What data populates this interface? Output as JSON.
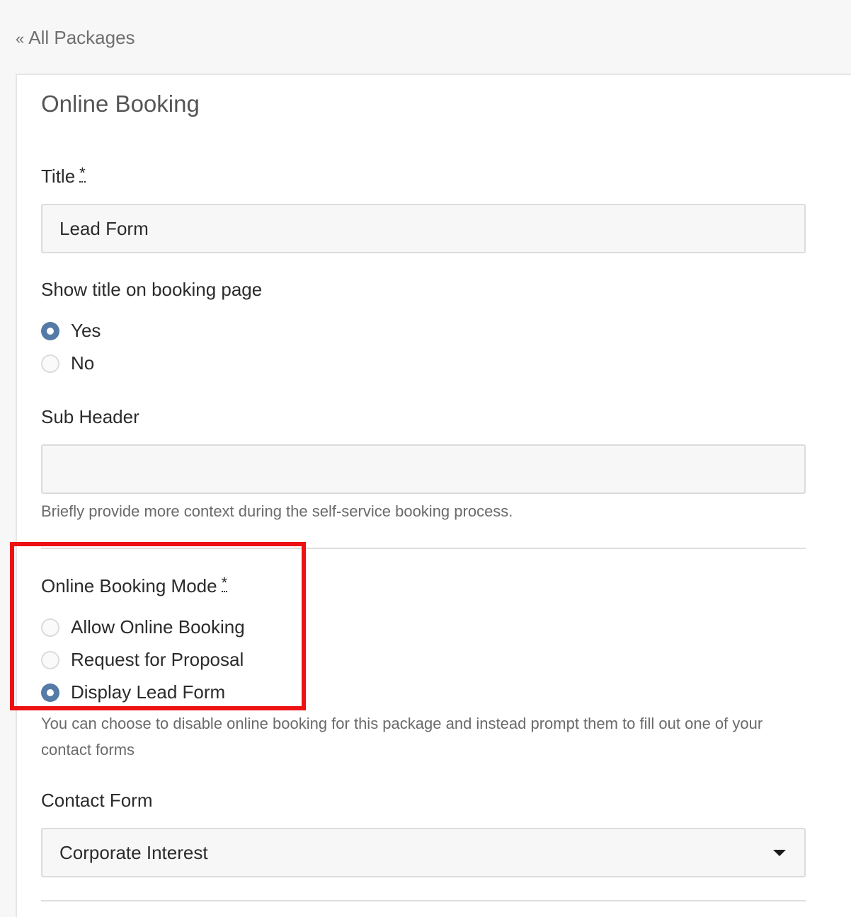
{
  "nav": {
    "back_chevron": "«",
    "back_label": "All Packages"
  },
  "panel": {
    "title": "Online Booking"
  },
  "title_field": {
    "label": "Title",
    "required_mark": "*",
    "value": "Lead Form"
  },
  "show_title": {
    "label": "Show title on booking page",
    "options": [
      {
        "label": "Yes",
        "checked": true
      },
      {
        "label": "No",
        "checked": false
      }
    ]
  },
  "sub_header": {
    "label": "Sub Header",
    "value": "",
    "help": "Briefly provide more context during the self-service booking process."
  },
  "booking_mode": {
    "label": "Online Booking Mode",
    "required_mark": "*",
    "options": [
      {
        "label": "Allow Online Booking",
        "checked": false
      },
      {
        "label": "Request for Proposal",
        "checked": false
      },
      {
        "label": "Display Lead Form",
        "checked": true
      }
    ],
    "help": "You can choose to disable online booking for this package and instead prompt them to fill out one of your contact forms"
  },
  "contact_form": {
    "label": "Contact Form",
    "selected": "Corporate Interest",
    "caret_icon": "caret-down-icon"
  },
  "colors": {
    "accent": "#557aa6",
    "highlight": "#ee1111",
    "page_bg": "#f7f7f7"
  }
}
